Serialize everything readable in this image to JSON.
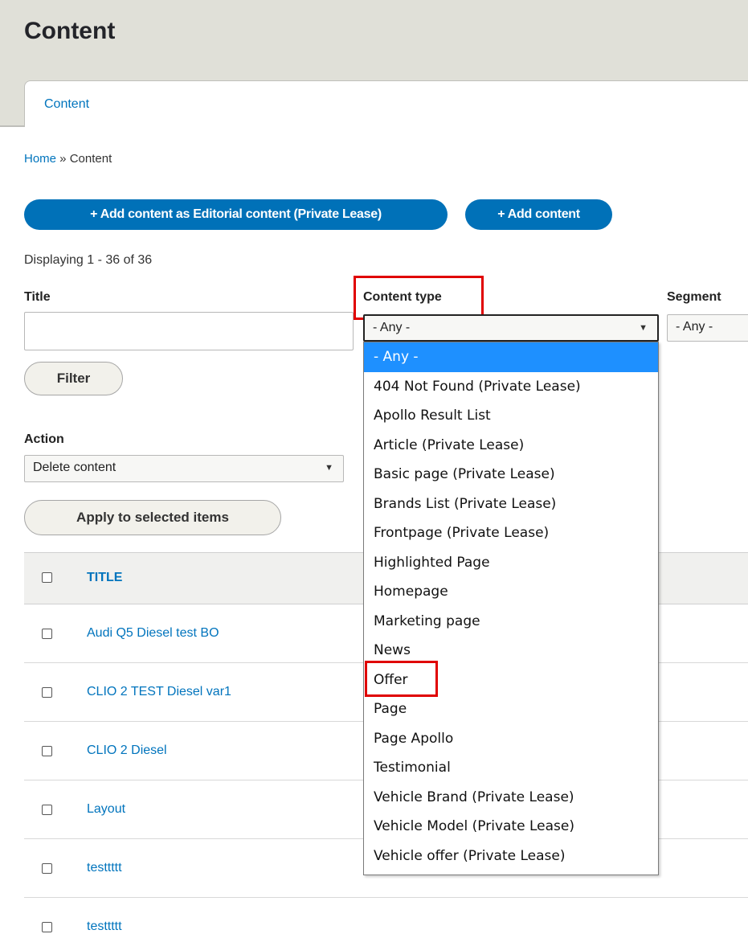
{
  "header": {
    "title": "Content"
  },
  "tabs": [
    {
      "label": "Content"
    }
  ],
  "breadcrumb": {
    "home": "Home",
    "separator": " » ",
    "current": "Content"
  },
  "actions": {
    "add_editorial": "+ Add content as Editorial content (Private Lease)",
    "add_content": "+ Add content"
  },
  "summary": "Displaying 1 - 36 of 36",
  "filters": {
    "title_label": "Title",
    "title_value": "",
    "content_type_label": "Content type",
    "content_type_value": "- Any -",
    "segment_label": "Segment",
    "segment_value": "- Any -",
    "filter_button": "Filter"
  },
  "bulk": {
    "action_label": "Action",
    "action_value": "Delete content",
    "apply_button": "Apply to selected items"
  },
  "table": {
    "header_title": "TITLE",
    "rows": [
      {
        "title": "Audi Q5 Diesel test BO"
      },
      {
        "title": "CLIO 2 TEST Diesel var1"
      },
      {
        "title": "CLIO 2 Diesel"
      },
      {
        "title": "Layout"
      },
      {
        "title": "testtttt"
      },
      {
        "title": "testtttt"
      }
    ]
  },
  "dropdown": {
    "options": [
      "- Any -",
      "404 Not Found (Private Lease)",
      "Apollo Result List",
      "Article (Private Lease)",
      "Basic page (Private Lease)",
      "Brands List (Private Lease)",
      "Frontpage (Private Lease)",
      "Highlighted Page",
      "Homepage",
      "Marketing page",
      "News",
      "Offer",
      "Page",
      "Page Apollo",
      "Testimonial",
      "Vehicle Brand (Private Lease)",
      "Vehicle Model (Private Lease)",
      "Vehicle offer (Private Lease)"
    ],
    "selected_index": 0
  },
  "colors": {
    "accent": "#0071b8",
    "link": "#0074bd",
    "highlight": "#e00000",
    "selected_option": "#1e90ff"
  }
}
